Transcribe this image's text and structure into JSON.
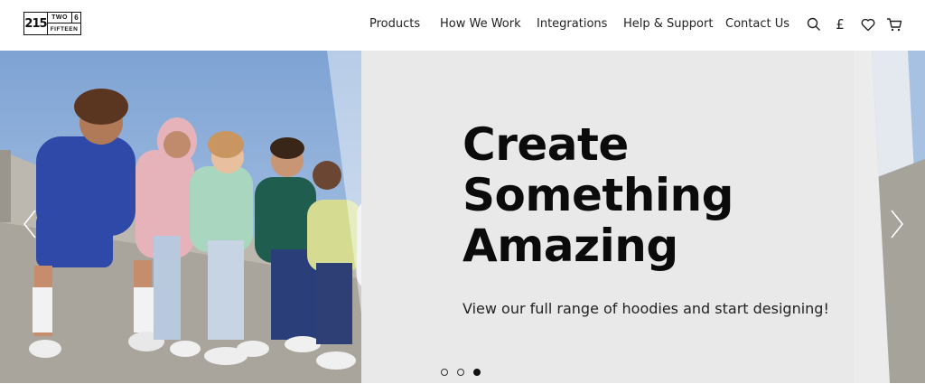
{
  "logo": {
    "number": "215",
    "word_top": "TWO",
    "digit": "6",
    "word_bottom": "FIFTEEN"
  },
  "nav": {
    "items": [
      {
        "label": "Products"
      },
      {
        "label": "How We Work"
      },
      {
        "label": "Integrations"
      },
      {
        "label": "Help & Support"
      },
      {
        "label": "Contact Us"
      }
    ]
  },
  "header_icons": {
    "search": "search-icon",
    "currency": "£",
    "wishlist": "heart-icon",
    "cart": "cart-icon"
  },
  "hero": {
    "headline_line1": "Create",
    "headline_line2": "Something",
    "headline_line3": "Amazing",
    "subtitle": "View our full range of hoodies and start designing!",
    "slides_total": 3,
    "active_slide": 3
  },
  "colors": {
    "text": "#0b0b0b",
    "panel_bg": "#e9e9e9",
    "sky": "#8fb0d8",
    "wall": "#b9b6ae"
  }
}
